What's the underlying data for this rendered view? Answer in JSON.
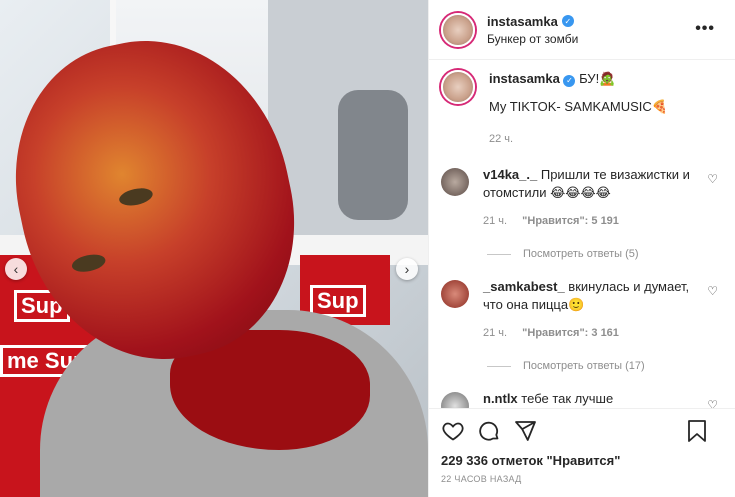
{
  "post": {
    "username": "instasamka",
    "location": "Бункер от зомби",
    "caption_text": "БУ!🧟",
    "caption_line2": "My TIKTOK- SAMKAMUSIC🍕",
    "caption_time": "22 ч."
  },
  "comments": [
    {
      "username": "v14ka_._",
      "text": "Пришли те визажистки и отомстили 😂😂😂😂",
      "time": "21 ч.",
      "likes": "\"Нравится\": 5 191",
      "replies": "Посмотреть ответы (5)"
    },
    {
      "username": "_samkabest_",
      "text": "вкинулась и думает, что она пицца🙂",
      "time": "21 ч.",
      "likes": "\"Нравится\": 3 161",
      "replies": "Посмотреть ответы (17)"
    },
    {
      "username": "n.ntlx",
      "text": "тебе так лучше"
    }
  ],
  "footer": {
    "likes_count": "229 336 отметок \"Нравится\"",
    "timestamp": "22 ЧАСОВ НАЗАД"
  },
  "photo": {
    "brand_text": "Sup",
    "brand_text2": "me Sup"
  },
  "icons": [
    "more-icon",
    "verified-icon",
    "heart-icon",
    "comment-icon",
    "share-icon",
    "bookmark-icon",
    "chevron-left-icon",
    "chevron-right-icon"
  ]
}
